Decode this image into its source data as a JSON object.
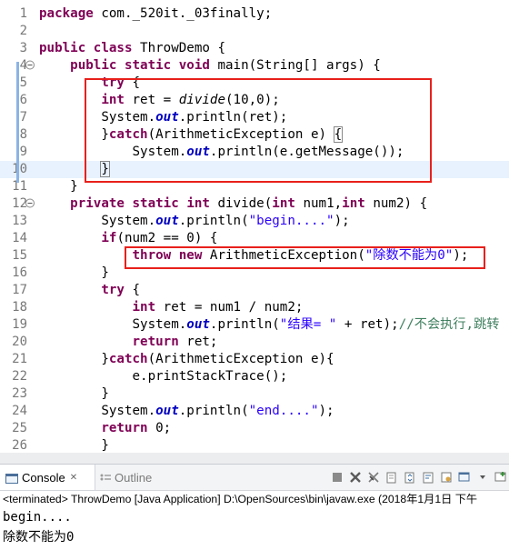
{
  "editor": {
    "lines": [
      {
        "num": "1",
        "html": "<span class='kw'>package</span> com._520it._03finally;"
      },
      {
        "num": "2",
        "html": ""
      },
      {
        "num": "3",
        "html": "<span class='kw'>public</span> <span class='kw'>class</span> ThrowDemo {"
      },
      {
        "num": "4",
        "html": "    <span class='kw'>public</span> <span class='kw'>static</span> <span class='kw'>void</span> main(String[] args) {"
      },
      {
        "num": "5",
        "html": "        <span class='kw'>try</span> {"
      },
      {
        "num": "6",
        "html": "        <span class='kw'>int</span> ret = <span class='static-m'>divide</span>(10,0);"
      },
      {
        "num": "7",
        "html": "        System.<span class='fld'>out</span>.println(ret);"
      },
      {
        "num": "8",
        "html": "        }<span class='kw'>catch</span>(ArithmeticException e) <span class='brace-match'>{</span>"
      },
      {
        "num": "9",
        "html": "            System.<span class='fld'>out</span>.println(e.getMessage());"
      },
      {
        "num": "10",
        "html": "        <span class='brace-match'>}</span>"
      },
      {
        "num": "11",
        "html": "    }"
      },
      {
        "num": "12",
        "html": "    <span class='kw'>private</span> <span class='kw'>static</span> <span class='kw'>int</span> divide(<span class='kw'>int</span> num1,<span class='kw'>int</span> num2) {"
      },
      {
        "num": "13",
        "html": "        System.<span class='fld'>out</span>.println(<span class='str'>\"begin....\"</span>);"
      },
      {
        "num": "14",
        "html": "        <span class='kw'>if</span>(num2 == 0) {"
      },
      {
        "num": "15",
        "html": "            <span class='kw'>throw</span> <span class='kw'>new</span> ArithmeticException(<span class='str'>\"除数不能为0\"</span>);"
      },
      {
        "num": "16",
        "html": "        }"
      },
      {
        "num": "17",
        "html": "        <span class='kw'>try</span> {"
      },
      {
        "num": "18",
        "html": "            <span class='kw'>int</span> ret = num1 / num2;"
      },
      {
        "num": "19",
        "html": "            System.<span class='fld'>out</span>.println(<span class='str'>\"结果= \"</span> + ret);<span class='cmt'>//不会执行,跳转</span>"
      },
      {
        "num": "20",
        "html": "            <span class='kw'>return</span> ret;"
      },
      {
        "num": "21",
        "html": "        }<span class='kw'>catch</span>(ArithmeticException e){"
      },
      {
        "num": "22",
        "html": "            e.printStackTrace();"
      },
      {
        "num": "23",
        "html": "        }"
      },
      {
        "num": "24",
        "html": "        System.<span class='fld'>out</span>.println(<span class='str'>\"end....\"</span>);"
      },
      {
        "num": "25",
        "html": "        <span class='kw'>return</span> 0;"
      },
      {
        "num": "26",
        "html": "        }"
      }
    ]
  },
  "console_view": {
    "tab_console": "Console",
    "tab_close": "✕",
    "tab_outline": "Outline",
    "status": "<terminated> ThrowDemo [Java Application] D:\\OpenSources\\bin\\javaw.exe (2018年1月1日 下午",
    "output": [
      "begin....",
      "除数不能为0"
    ]
  },
  "colors": {
    "keyword": "#7f0055",
    "string": "#2a00ff",
    "field": "#0000c0",
    "comment": "#3f7f5f",
    "highlight_box": "#e8201b",
    "current_line": "#e8f2fe"
  }
}
